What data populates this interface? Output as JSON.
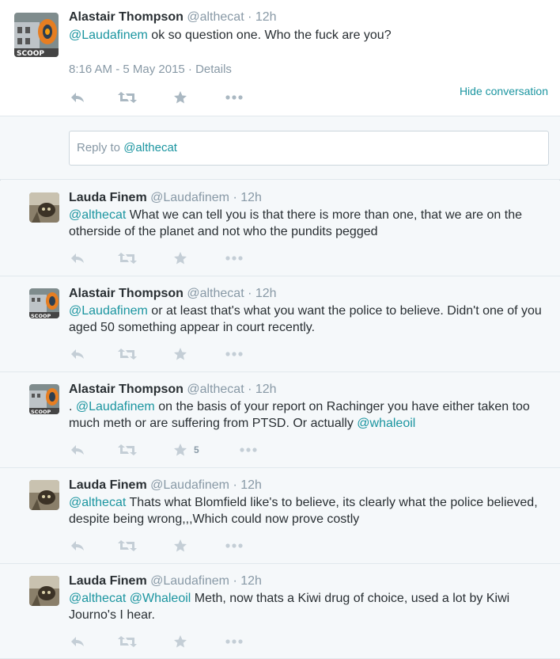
{
  "main_tweet": {
    "name": "Alastair Thompson",
    "handle": "@althecat",
    "time": "· 12h",
    "mention": "@Laudafinem",
    "text": " ok so question one. Who the fuck are you?",
    "timestamp": "8:16 AM - 5 May 2015 · Details",
    "hide_conversation": "Hide conversation"
  },
  "reply": {
    "prefix": "Reply to ",
    "mention": "@althecat"
  },
  "tweets": [
    {
      "name": "Lauda Finem",
      "handle": "@Laudafinem",
      "time": "· 12h",
      "mention1": "@althecat",
      "text": " What we can tell you is that there is more than one, that we are on the otherside of the planet and not who the pundits pegged",
      "favorites": ""
    },
    {
      "name": "Alastair Thompson",
      "handle": "@althecat",
      "time": "· 12h",
      "mention1": "@Laudafinem",
      "text": " or at least that's what you want the police to believe. Didn't one of you aged 50 something appear in court recently.",
      "favorites": ""
    },
    {
      "name": "Alastair Thompson",
      "handle": "@althecat",
      "time": "· 12h",
      "prefix": ". ",
      "mention1": "@Laudafinem",
      "text": " on the basis of your report on Rachinger you have either taken too much meth or are suffering from PTSD. Or actually ",
      "mention2": "@whaleoil",
      "favorites": "5"
    },
    {
      "name": "Lauda Finem",
      "handle": "@Laudafinem",
      "time": "· 12h",
      "mention1": "@althecat",
      "text": " Thats what Blomfield like's to believe, its clearly what the police believed, despite being wrong,,,Which could now prove costly",
      "favorites": ""
    },
    {
      "name": "Lauda Finem",
      "handle": "@Laudafinem",
      "time": "· 12h",
      "mention1": "@althecat",
      "mention2": "@Whaleoil",
      "text": " Meth, now thats a Kiwi drug of choice, used a lot by Kiwi Journo's I hear.",
      "favorites": ""
    }
  ],
  "icons": {
    "reply": "reply-icon",
    "retweet": "retweet-icon",
    "favorite": "star-icon",
    "more": "more-icon"
  },
  "colors": {
    "link": "#1b95a0",
    "meta": "#8899a6",
    "icon": "#aab8c2",
    "background": "#f5f8fa"
  }
}
